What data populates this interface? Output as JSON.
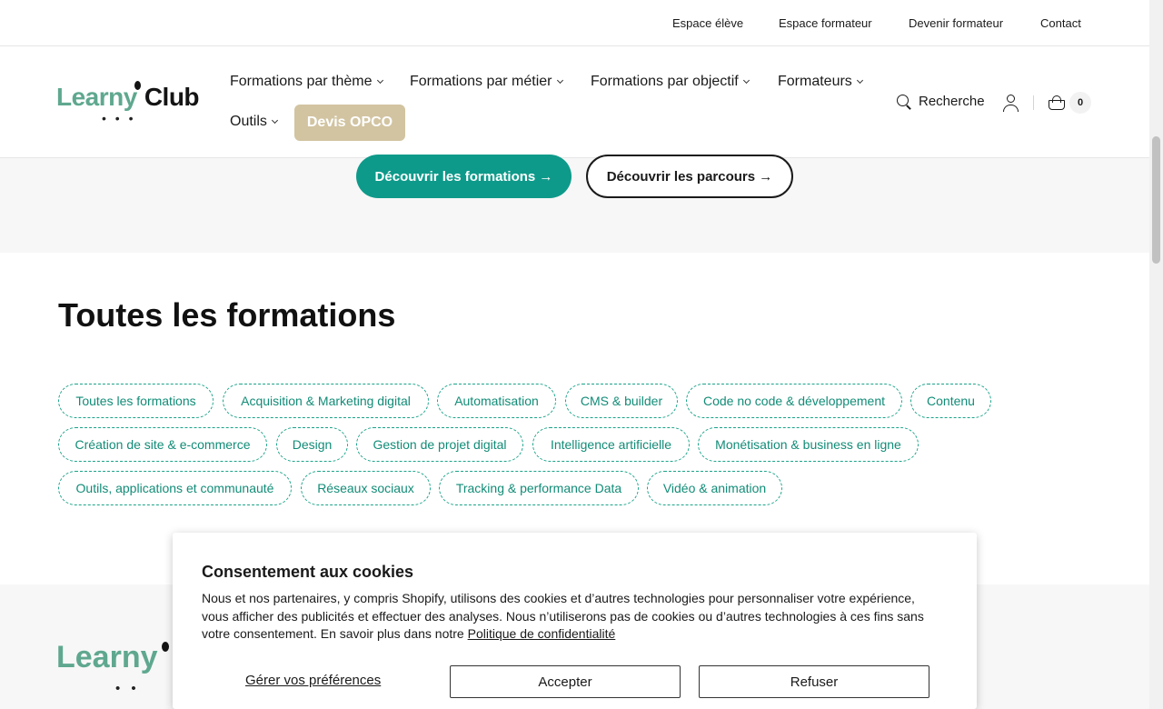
{
  "topbar": {
    "links": [
      "Espace élève",
      "Espace formateur",
      "Devenir formateur",
      "Contact"
    ]
  },
  "logo": {
    "part1": "Learny",
    "part2": "Club"
  },
  "nav": {
    "items": [
      "Formations par thème",
      "Formations par métier",
      "Formations par objectif",
      "Formateurs",
      "Outils"
    ],
    "devis_label": "Devis OPCO",
    "search_label": "Recherche",
    "cart_count": "0"
  },
  "hero": {
    "primary_cta": "Découvrir les formations →",
    "secondary_cta": "Découvrir les parcours →"
  },
  "main": {
    "title": "Toutes les formations",
    "chips": [
      "Toutes les formations",
      "Acquisition & Marketing digital",
      "Automatisation",
      "CMS & builder",
      "Code no code & développement",
      "Contenu",
      "Création de site & e-commerce",
      "Design",
      "Gestion de projet digital",
      "Intelligence artificielle",
      "Monétisation & business en ligne",
      "Outils, applications et communauté",
      "Réseaux sociaux",
      "Tracking & performance Data",
      "Vidéo & animation"
    ]
  },
  "footer": {
    "logo": "Learny"
  },
  "cookie": {
    "title": "Consentement aux cookies",
    "body": "Nous et nos partenaires, y compris Shopify, utilisons des cookies et d’autres technologies pour personnaliser votre expérience, vous afficher des publicités et effectuer des analyses. Nous n’utiliserons pas de cookies ou d’autres technologies à ces fins sans votre consentement. En savoir plus dans notre",
    "policy_link": "Politique de confidentialité",
    "preferences": "Gérer vos préférences",
    "accept": "Accepter",
    "refuse": "Refuser"
  },
  "colors": {
    "brand_green": "#5fa88f",
    "teal": "#0e9a8a",
    "chip_text": "#128c77",
    "devis_bg": "#d2c4a1"
  }
}
